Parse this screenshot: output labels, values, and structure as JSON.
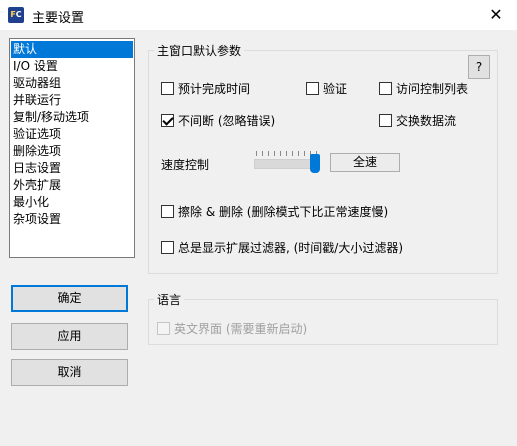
{
  "window": {
    "title": "主要设置",
    "icon_text": "FC",
    "close_label": "✕"
  },
  "sidebar": {
    "items": [
      {
        "label": "默认",
        "selected": true
      },
      {
        "label": "I/O 设置",
        "selected": false
      },
      {
        "label": "驱动器组",
        "selected": false
      },
      {
        "label": "并联运行",
        "selected": false
      },
      {
        "label": "复制/移动选项",
        "selected": false
      },
      {
        "label": "验证选项",
        "selected": false
      },
      {
        "label": "删除选项",
        "selected": false
      },
      {
        "label": "日志设置",
        "selected": false
      },
      {
        "label": "外壳扩展",
        "selected": false
      },
      {
        "label": "最小化",
        "selected": false
      },
      {
        "label": "杂项设置",
        "selected": false
      }
    ]
  },
  "buttons": {
    "ok": "确定",
    "apply": "应用",
    "cancel": "取消"
  },
  "main_group": {
    "title": "主窗口默认参数",
    "help_label": "?",
    "estimate_time": {
      "label": "预计完成时间",
      "checked": false
    },
    "verify": {
      "label": "验证",
      "checked": false
    },
    "acl": {
      "label": "访问控制列表",
      "checked": false
    },
    "no_interrupt": {
      "label": "不间断 (忽略错误)",
      "checked": true
    },
    "alt_streams": {
      "label": "交换数据流",
      "checked": false
    },
    "speed_label": "速度控制",
    "speed_value": "全速",
    "speed_level": 1.0,
    "wipe_delete": {
      "label": "擦除 & 删除 (删除模式下比正常速度慢)",
      "checked": false
    },
    "show_filter": {
      "label": "总是显示扩展过滤器, (时间戳/大小过滤器)",
      "checked": false
    }
  },
  "language_group": {
    "title": "语言",
    "english_ui": {
      "label": "英文界面 (需要重新启动)",
      "checked": false,
      "disabled": true
    }
  },
  "colors": {
    "accent": "#0078d7",
    "background": "#f0f0f0"
  }
}
